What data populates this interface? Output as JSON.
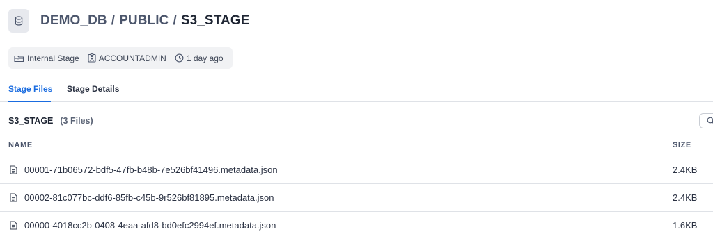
{
  "header": {
    "icon": "database-icon",
    "breadcrumb": {
      "database": "DEMO_DB",
      "separator": "/",
      "schema": "PUBLIC",
      "stage": "S3_STAGE"
    }
  },
  "meta": {
    "stage_type": "Internal Stage",
    "owner": "ACCOUNTADMIN",
    "updated": "1 day ago"
  },
  "tabs": [
    {
      "label": "Stage Files",
      "active": true
    },
    {
      "label": "Stage Details",
      "active": false
    }
  ],
  "files_section": {
    "title": "S3_STAGE",
    "count": "(3 Files)"
  },
  "table": {
    "columns": {
      "name": "NAME",
      "size": "SIZE"
    },
    "rows": [
      {
        "name": "00001-71b06572-bdf5-47fb-b48b-7e526bf41496.metadata.json",
        "size": "2.4KB"
      },
      {
        "name": "00002-81c077bc-ddf6-85fb-c45b-9r526bf81895.metadata.json",
        "size": "2.4KB"
      },
      {
        "name": "00000-4018cc2b-0408-4eaa-afd8-bd0efc2994ef.metadata.json",
        "size": "1.6KB"
      }
    ]
  },
  "colors": {
    "accent": "#1a6ce0",
    "border": "#dfe2e7",
    "pill_bg": "#f1f2f4"
  }
}
